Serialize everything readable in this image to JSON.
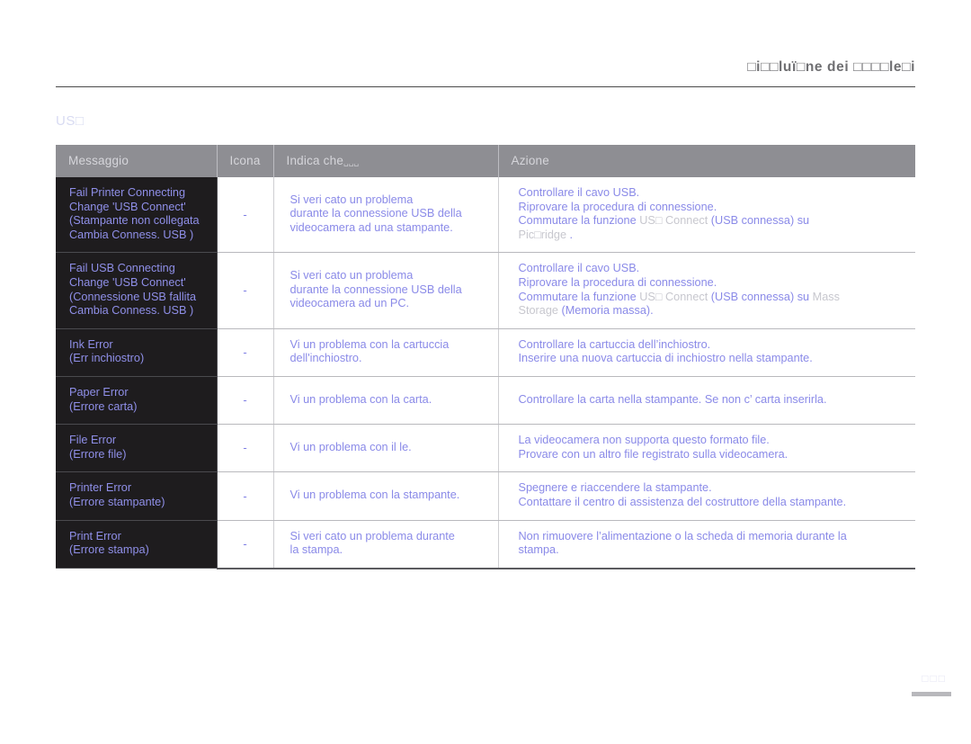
{
  "header": {
    "title": "□i□□luï□ne dei □□□□le□i",
    "title_plain": "Risoluzione dei problemi"
  },
  "section": {
    "label": "US□",
    "label_plain": "USB"
  },
  "table": {
    "columns": [
      {
        "label": "Messaggio"
      },
      {
        "label": "Icona"
      },
      {
        "label": "Indica che",
        "suffix": "␣␣␣"
      },
      {
        "label": "Azione"
      }
    ],
    "rows": [
      {
        "message": "Fail Printer Connecting\nChange 'USB Connect'\n(Stampante non collegata\nCambia  Conness. USB )",
        "icon": "-",
        "indicates": "Si  veri cato un problema\ndurante la connessione USB della\nvideocamera ad una stampante.",
        "action_lines": [
          {
            "segments": [
              {
                "text": "Controllare il cavo USB.",
                "dim": false
              }
            ]
          },
          {
            "segments": [
              {
                "text": "Riprovare la procedura di connessione.",
                "dim": false
              }
            ]
          },
          {
            "segments": [
              {
                "text": "Commutare la funzione ",
                "dim": false
              },
              {
                "text": "US□ Connect",
                "dim": true
              },
              {
                "text": " (USB connessa) su",
                "dim": false
              }
            ]
          },
          {
            "segments": [
              {
                "text": "Pic□ridge",
                "dim": true
              },
              {
                "text": " .",
                "dim": false
              }
            ]
          }
        ]
      },
      {
        "message": "Fail USB Connecting\nChange 'USB Connect'\n(Connessione USB fallita\nCambia  Conness. USB )",
        "icon": "-",
        "indicates": "Si  veri cato un problema\ndurante la connessione USB della\nvideocamera ad un PC.",
        "action_lines": [
          {
            "segments": [
              {
                "text": "Controllare il cavo USB.",
                "dim": false
              }
            ]
          },
          {
            "segments": [
              {
                "text": "Riprovare la procedura di connessione.",
                "dim": false
              }
            ]
          },
          {
            "segments": [
              {
                "text": "Commutare la funzione ",
                "dim": false
              },
              {
                "text": "US□ Connect",
                "dim": true
              },
              {
                "text": " (USB connessa) su ",
                "dim": false
              },
              {
                "text": "Mass",
                "dim": true
              }
            ]
          },
          {
            "segments": [
              {
                "text": "Storage",
                "dim": true
              },
              {
                "text": " (Memoria massa).",
                "dim": false
              }
            ]
          }
        ]
      },
      {
        "message": "Ink Error\n(Err inchiostro)",
        "icon": "-",
        "indicates": "Vi  un problema con la cartuccia\ndell'inchiostro.",
        "action_lines": [
          {
            "segments": [
              {
                "text": "Controllare la cartuccia dell’inchiostro.",
                "dim": false
              }
            ]
          },
          {
            "segments": [
              {
                "text": "Inserire una nuova cartuccia di inchiostro nella stampante.",
                "dim": false
              }
            ]
          }
        ]
      },
      {
        "message": "Paper Error\n(Errore carta)",
        "icon": "-",
        "indicates": "Vi  un problema con la carta.",
        "action_lines": [
          {
            "segments": [
              {
                "text": "Controllare la carta nella stampante. Se non c’ carta  inserirla.",
                "dim": false
              }
            ]
          }
        ]
      },
      {
        "message": "File Error\n(Errore file)",
        "icon": "-",
        "indicates": "Vi  un problema con il  le.",
        "action_lines": [
          {
            "segments": [
              {
                "text": "La videocamera non supporta questo formato file.",
                "dim": false
              }
            ]
          },
          {
            "segments": [
              {
                "text": "Provare con un altro file registrato sulla videocamera.",
                "dim": false
              }
            ]
          }
        ]
      },
      {
        "message": "Printer Error\n(Errore stampante)",
        "icon": "-",
        "indicates": "Vi  un problema con la stampante.",
        "action_lines": [
          {
            "segments": [
              {
                "text": "Spegnere e riaccendere la stampante.",
                "dim": false
              }
            ]
          },
          {
            "segments": [
              {
                "text": "Contattare il centro di assistenza del costruttore della stampante.",
                "dim": false
              }
            ]
          }
        ]
      },
      {
        "message": "Print Error\n(Errore stampa)",
        "icon": "-",
        "indicates": "Si  veri cato un problema durante\nla stampa.",
        "action_lines": [
          {
            "segments": [
              {
                "text": "Non rimuovere l’alimentazione o la scheda di memoria durante la",
                "dim": false
              }
            ]
          },
          {
            "segments": [
              {
                "text": "stampa.",
                "dim": false
              }
            ]
          }
        ]
      }
    ]
  },
  "footer": {
    "page_number": "□□□"
  },
  "colors": {
    "message_text": "#8f8fe8",
    "body_text": "#8a8ae8",
    "dim_text": "#c7c7ce",
    "message_bg": "#1e1c1e",
    "header_bg": "#8e8e93",
    "header_text": "#d5d5da"
  }
}
